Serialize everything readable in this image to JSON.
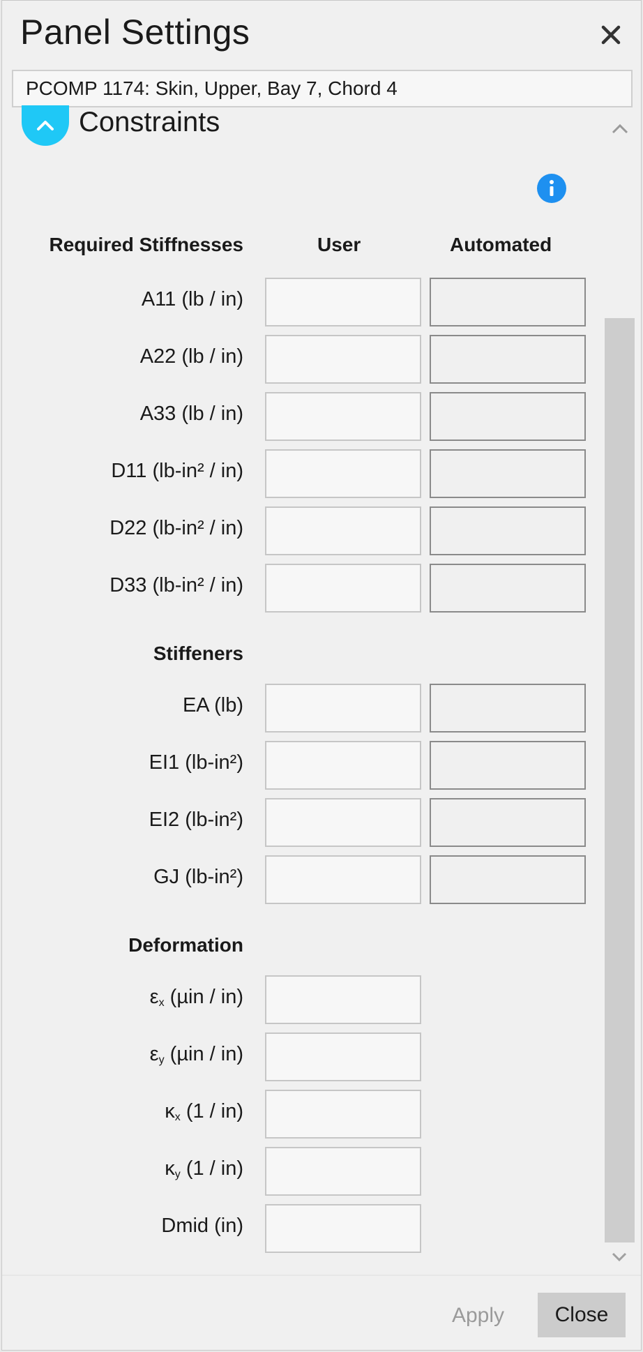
{
  "dialog": {
    "title": "Panel Settings",
    "close_icon": "close-icon",
    "panel_name": "PCOMP 1174: Skin, Upper, Bay 7, Chord 4"
  },
  "section": {
    "title": "Constraints",
    "collapse_icon": "chevron-up-icon",
    "info_icon": "info-icon"
  },
  "columns": {
    "required_stiffnesses": "Required Stiffnesses",
    "user": "User",
    "automated": "Automated"
  },
  "required_stiffnesses": [
    {
      "name": "A11",
      "unit": "(lb / in)",
      "user": "",
      "automated": ""
    },
    {
      "name": "A22",
      "unit": "(lb / in)",
      "user": "",
      "automated": ""
    },
    {
      "name": "A33",
      "unit": "(lb / in)",
      "user": "",
      "automated": ""
    },
    {
      "name": "D11",
      "unit": "(lb-in² / in)",
      "user": "",
      "automated": ""
    },
    {
      "name": "D22",
      "unit": "(lb-in² / in)",
      "user": "",
      "automated": ""
    },
    {
      "name": "D33",
      "unit": "(lb-in² / in)",
      "user": "",
      "automated": ""
    }
  ],
  "stiffeners": {
    "heading": "Stiffeners",
    "rows": [
      {
        "name": "EA",
        "unit": "(lb)",
        "user": "",
        "automated": ""
      },
      {
        "name": "EI1",
        "unit": "(lb-in²)",
        "user": "",
        "automated": ""
      },
      {
        "name": "EI2",
        "unit": "(lb-in²)",
        "user": "",
        "automated": ""
      },
      {
        "name": "GJ",
        "unit": "(lb-in²)",
        "user": "",
        "automated": ""
      }
    ]
  },
  "deformation": {
    "heading": "Deformation",
    "rows": [
      {
        "symbol": "ε",
        "sub": "x",
        "unit": "(µin / in)",
        "user": ""
      },
      {
        "symbol": "ε",
        "sub": "y",
        "unit": "(µin / in)",
        "user": ""
      },
      {
        "symbol": "κ",
        "sub": "x",
        "unit": "(1 / in)",
        "user": ""
      },
      {
        "symbol": "κ",
        "sub": "y",
        "unit": "(1 / in)",
        "user": ""
      },
      {
        "symbol": "Dmid",
        "sub": "",
        "unit": "(in)",
        "user": ""
      }
    ]
  },
  "footer": {
    "apply_label": "Apply",
    "close_label": "Close"
  }
}
